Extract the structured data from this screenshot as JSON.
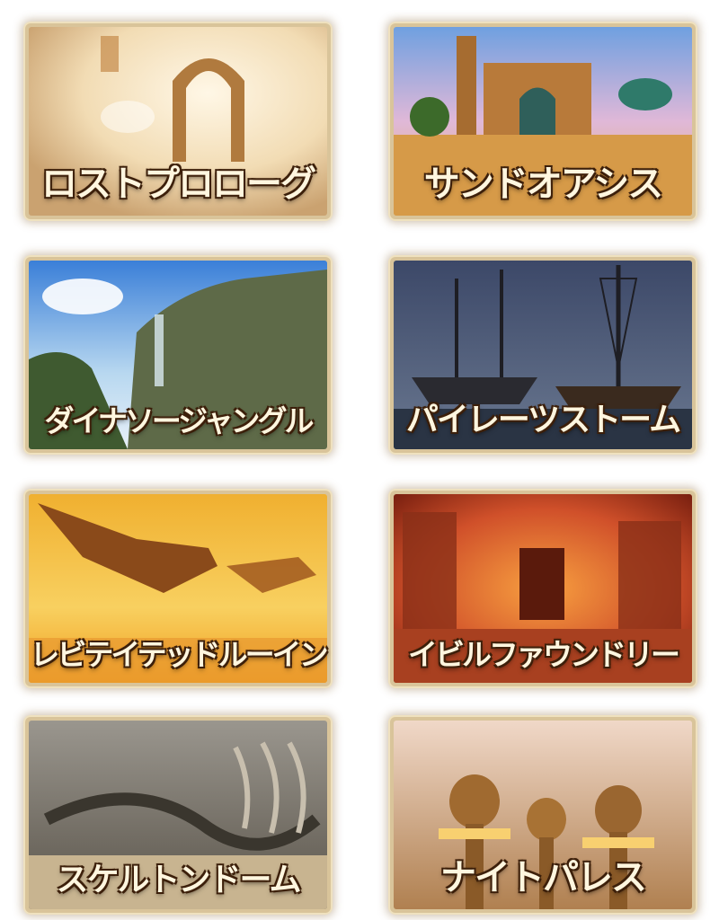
{
  "stages": [
    {
      "title": "ロストプロローグ",
      "scene": "ruin-arch-icon"
    },
    {
      "title": "サンドオアシス",
      "scene": "desert-palace-icon"
    },
    {
      "title": "ダイナソージャングル",
      "scene": "jungle-cliff-icon"
    },
    {
      "title": "パイレーツストーム",
      "scene": "pirate-ship-icon"
    },
    {
      "title": "レビテイテッドルーイン",
      "scene": "floating-ruin-icon"
    },
    {
      "title": "イビルファウンドリー",
      "scene": "foundry-icon"
    },
    {
      "title": "スケルトンドーム",
      "scene": "skeleton-bones-icon"
    },
    {
      "title": "ナイトパレス",
      "scene": "night-palace-icon"
    }
  ]
}
